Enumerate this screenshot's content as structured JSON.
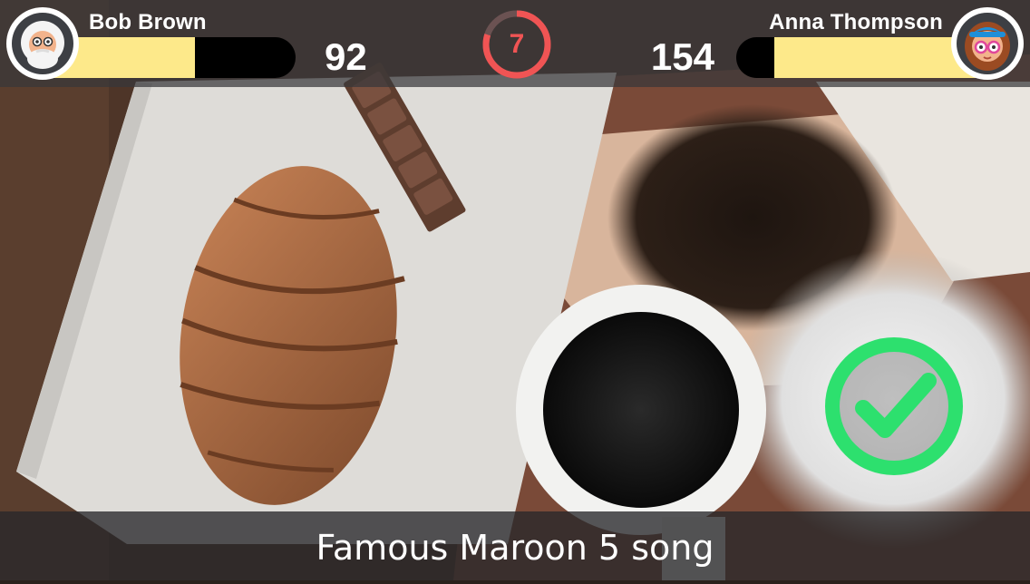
{
  "players": {
    "left": {
      "name": "Bob Brown",
      "score": "92",
      "progress": 0.6,
      "avatar_icon": "old-man-avatar-icon"
    },
    "right": {
      "name": "Anna Thompson",
      "score": "154",
      "progress": 0.85,
      "avatar_icon": "girl-with-glasses-avatar-icon"
    }
  },
  "timer": {
    "value": "7",
    "progress": 0.8,
    "color": "#f05454"
  },
  "feedback": {
    "icon": "green-checkmark-icon",
    "color": "#2de06e"
  },
  "question": {
    "text": "Famous Maroon 5 song"
  },
  "colors": {
    "bar_fill": "#fde98a",
    "bar_track": "#000000",
    "hud_bg": "#37373a"
  }
}
